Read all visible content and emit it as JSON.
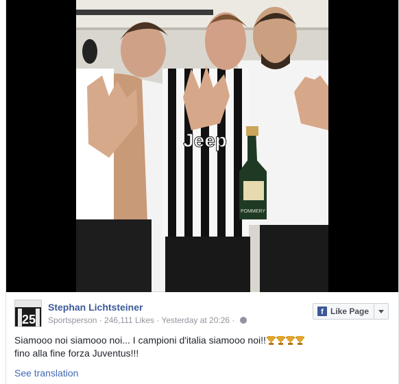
{
  "post": {
    "author": "Stephan Lichtsteiner",
    "category": "Sportsperson",
    "likes": "246,111 Likes",
    "timestamp": "Yesterday at 20:26",
    "separator": " · ",
    "text_line1": "Siamooo noi siamooo noi... I campioni d'italia siamooo noi!!",
    "text_line2": "fino alla fine forza Juventus!!!",
    "trophy_count": 4,
    "see_translation": "See translation"
  },
  "like_button": {
    "label": "Like Page",
    "logo": "f"
  },
  "photo": {
    "description_icon": "photo-image",
    "jersey_text": "Jeep",
    "bottle_label": "POMMERY"
  },
  "avatar": {
    "number": "25"
  },
  "colors": {
    "link": "#3b5998",
    "meta": "#90949c",
    "text": "#1d2129",
    "translation": "#4267b2"
  }
}
